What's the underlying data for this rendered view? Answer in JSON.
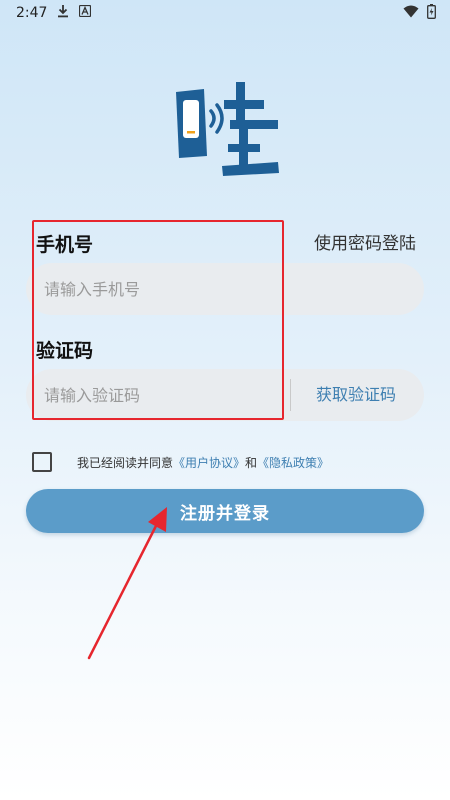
{
  "status_bar": {
    "time": "2:47",
    "icons": [
      "download-icon",
      "a-badge-icon",
      "wifi-icon",
      "battery-icon"
    ]
  },
  "logo": {
    "text": "哇",
    "brand_color": "#1e5f96"
  },
  "form": {
    "phone_label": "手机号",
    "phone_placeholder": "请输入手机号",
    "code_label": "验证码",
    "code_placeholder": "请输入验证码",
    "get_code_label": "获取验证码",
    "switch_login": "使用密码登陆"
  },
  "agreement": {
    "prefix": "我已经阅读并同意",
    "user_agreement": "《用户协议》",
    "and": "和",
    "privacy_policy": "《隐私政策》"
  },
  "submit": {
    "label": "注册并登录"
  },
  "colors": {
    "accent": "#5b9cc9",
    "link": "#3e7fb1",
    "annotation": "#e6262e"
  }
}
